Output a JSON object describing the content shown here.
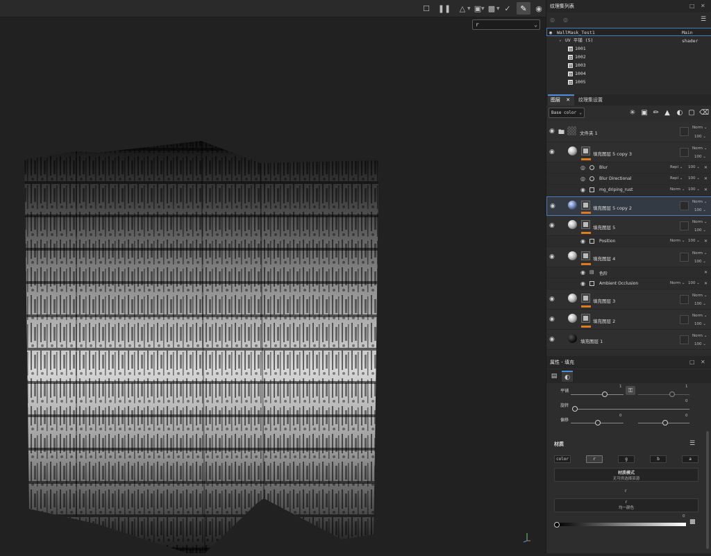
{
  "viewport": {
    "toolbar_icons": [
      "hide-ui-icon",
      "pause-icon",
      "selection-mode-icon",
      "camera-view-icon",
      "render-camera-icon",
      "brush-settings-icon",
      "paint-brush-icon",
      "screenshot-icon"
    ],
    "channel_select": {
      "value": "r"
    }
  },
  "texture_set_list": {
    "title": "纹理集列表",
    "set": {
      "name": "WallMask_Test1",
      "shader": "Main shader"
    },
    "uv_group": {
      "label": "UV 平铺 (5)"
    },
    "tiles": [
      "1001",
      "1002",
      "1003",
      "1004",
      "1005"
    ]
  },
  "layers_panel": {
    "tabs": [
      {
        "label": "图层"
      },
      {
        "label": "纹理集设置"
      }
    ],
    "channel_dropdown": "Base color",
    "layers": [
      {
        "name": "文件夹 1",
        "blend": "Norm",
        "opacity": "100",
        "type": "folder"
      },
      {
        "name": "填充图层 5 copy 3",
        "blend": "Norm",
        "opacity": "100",
        "type": "fill",
        "effects": [
          {
            "name": "Blur",
            "blend": "Repl",
            "opacity": "100"
          },
          {
            "name": "Blur Directional",
            "blend": "Repl",
            "opacity": "100"
          },
          {
            "name": "mg_driping_rust",
            "blend": "Norm",
            "opacity": "100"
          }
        ]
      },
      {
        "name": "填充图层 5 copy 2",
        "blend": "Norm",
        "opacity": "100",
        "type": "fill",
        "selected": true
      },
      {
        "name": "填充图层 5",
        "blend": "Norm",
        "opacity": "100",
        "type": "fill",
        "effects": [
          {
            "name": "Position",
            "blend": "Norm",
            "opacity": "100"
          }
        ]
      },
      {
        "name": "填充图层 4",
        "blend": "Norm",
        "opacity": "100",
        "type": "fill",
        "effects": [
          {
            "name": "色阶",
            "blend": "",
            "opacity": ""
          },
          {
            "name": "Ambient Occlusion",
            "blend": "Norm",
            "opacity": "100"
          }
        ]
      },
      {
        "name": "填充图层 3",
        "blend": "Norm",
        "opacity": "100",
        "type": "fill"
      },
      {
        "name": "填充图层 2",
        "blend": "Norm",
        "opacity": "100",
        "type": "fill"
      },
      {
        "name": "填充图层 1",
        "blend": "Norm",
        "opacity": "100",
        "type": "fill-dark"
      }
    ]
  },
  "properties": {
    "title": "属性 - 填充",
    "tiling": {
      "label": "平铺",
      "value1": "1",
      "value2": "1"
    },
    "rotation": {
      "label": "旋转",
      "value": "0"
    },
    "offset": {
      "label": "偏移",
      "value_x": "0",
      "value_y": "0"
    },
    "material": {
      "title": "材质",
      "channels": [
        "color",
        "r",
        "g",
        "b",
        "a"
      ],
      "active_channel": "r",
      "mode_label": "材质模式",
      "mode_value": "无可供选择资源",
      "section_label": "r",
      "r_label": "r",
      "r_value": "均一颜色",
      "gradient_value": "0"
    }
  }
}
